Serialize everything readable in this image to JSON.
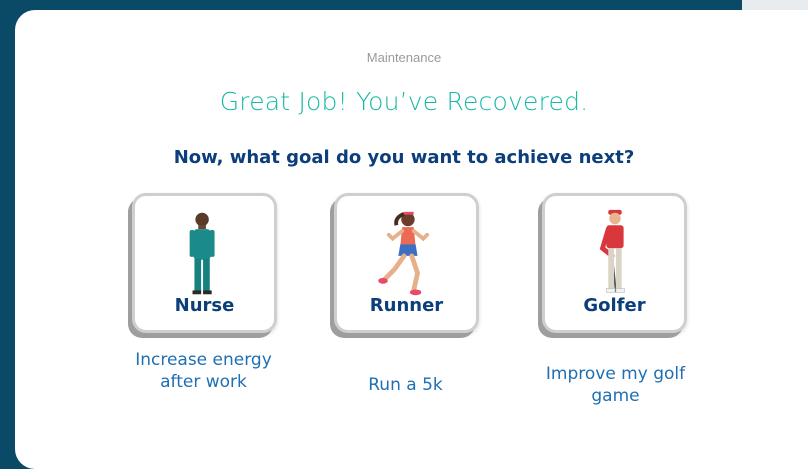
{
  "kicker": "Maintenance",
  "heading": "Great Job! You’ve Recovered.",
  "question": "Now, what goal do you want to achieve next?",
  "options": [
    {
      "label": "Nurse",
      "icon": "nurse-figure-icon",
      "description": "Increase energy after work"
    },
    {
      "label": "Runner",
      "icon": "runner-figure-icon",
      "description": "Run a 5k"
    },
    {
      "label": "Golfer",
      "icon": "golfer-figure-icon",
      "description": "Improve my golf game"
    }
  ],
  "colors": {
    "background": "#0b4a66",
    "heading": "#17b8a6",
    "question": "#0b3e7a",
    "description": "#1e6fb3"
  }
}
